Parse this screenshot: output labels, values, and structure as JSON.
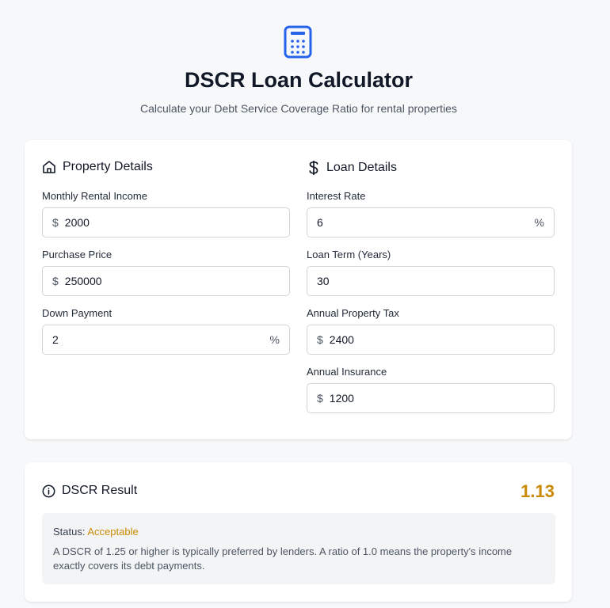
{
  "header": {
    "icon": "calculator-icon",
    "title": "DSCR Loan Calculator",
    "subtitle": "Calculate your Debt Service Coverage Ratio for rental properties"
  },
  "property": {
    "section_title": "Property Details",
    "section_icon": "home-icon",
    "rental_income": {
      "label": "Monthly Rental Income",
      "prefix": "$",
      "value": "2000"
    },
    "purchase_price": {
      "label": "Purchase Price",
      "prefix": "$",
      "value": "250000"
    },
    "down_payment": {
      "label": "Down Payment",
      "suffix": "%",
      "value": "2"
    }
  },
  "loan": {
    "section_title": "Loan Details",
    "section_icon": "dollar-icon",
    "interest_rate": {
      "label": "Interest Rate",
      "suffix": "%",
      "value": "6"
    },
    "loan_term": {
      "label": "Loan Term (Years)",
      "value": "30"
    },
    "property_tax": {
      "label": "Annual Property Tax",
      "prefix": "$",
      "value": "2400"
    },
    "insurance": {
      "label": "Annual Insurance",
      "prefix": "$",
      "value": "1200"
    }
  },
  "result": {
    "title": "DSCR Result",
    "icon": "info-icon",
    "value": "1.13",
    "status_label": "Status:",
    "status_value": "Acceptable",
    "description": "A DSCR of 1.25 or higher is typically preferred by lenders. A ratio of 1.0 means the property's income exactly covers its debt payments."
  },
  "colors": {
    "accent": "#2563eb",
    "status": "#ca8a04",
    "background": "#f7f8fa"
  }
}
